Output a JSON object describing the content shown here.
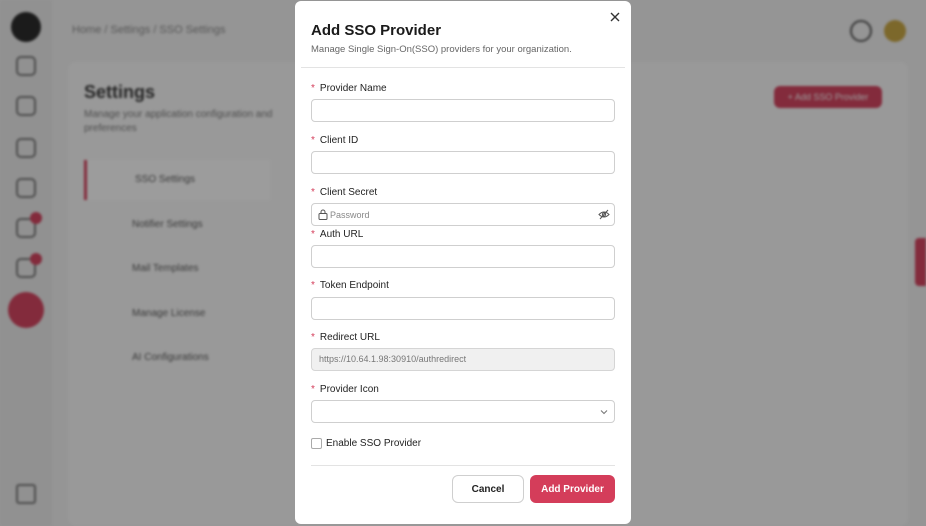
{
  "background": {
    "breadcrumb": "Home / Settings / SSO Settings",
    "title": "Settings",
    "description": "Manage your application configuration and preferences",
    "add_button": "+ Add SSO Provider",
    "menu": [
      "SSO Settings",
      "Notifier Settings",
      "Mail Templates",
      "Manage License",
      "AI Configurations"
    ]
  },
  "modal": {
    "title": "Add SSO Provider",
    "subtitle": "Manage Single Sign-On(SSO) providers for your organization.",
    "required_mark": "*",
    "fields": {
      "provider_name": {
        "label": "Provider Name",
        "value": ""
      },
      "client_id": {
        "label": "Client ID",
        "value": ""
      },
      "client_secret": {
        "label": "Client Secret",
        "placeholder": "Password"
      },
      "auth_url": {
        "label": "Auth URL",
        "value": ""
      },
      "token_endpoint": {
        "label": "Token Endpoint",
        "value": ""
      },
      "redirect_url": {
        "label": "Redirect URL",
        "value": "https://10.64.1.98:30910/authredirect"
      },
      "provider_icon": {
        "label": "Provider Icon",
        "value": ""
      }
    },
    "enable_label": "Enable SSO Provider",
    "cancel_label": "Cancel",
    "add_label": "Add Provider"
  },
  "colors": {
    "accent": "#d43d5a",
    "overlay": "rgba(20,20,20,0.42)"
  },
  "icons": [
    "close-icon",
    "lock-icon",
    "eye-off-icon",
    "chevron-down-icon"
  ]
}
